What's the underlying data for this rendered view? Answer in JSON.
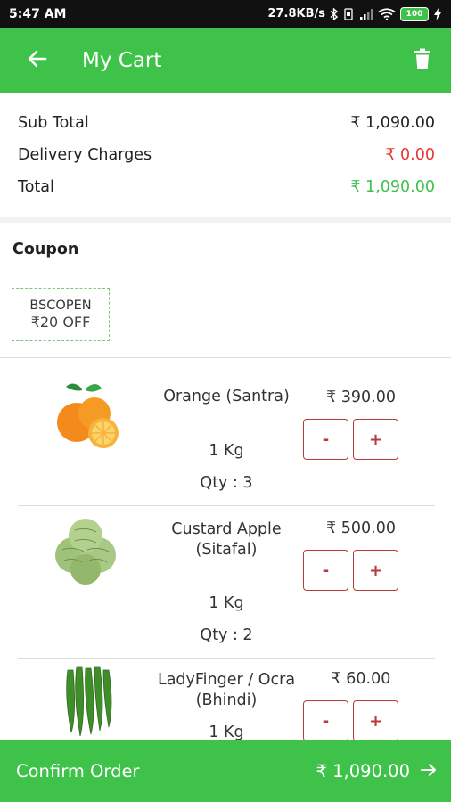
{
  "status_bar": {
    "time": "5:47 AM",
    "network_speed": "27.8KB/s",
    "battery_level": "100"
  },
  "app_bar": {
    "title": "My Cart",
    "back_icon": "arrow-left-icon",
    "delete_icon": "trash-icon"
  },
  "summary": {
    "subtotal_label": "Sub Total",
    "subtotal_value": "₹ 1,090.00",
    "delivery_label": "Delivery Charges",
    "delivery_value": "₹ 0.00",
    "total_label": "Total",
    "total_value": "₹ 1,090.00"
  },
  "coupon": {
    "heading": "Coupon",
    "code": "BSCOPEN",
    "discount": "₹20 OFF"
  },
  "items": [
    {
      "name": "Orange (Santra)",
      "unit": "1 Kg",
      "qty": "Qty : 3",
      "price": "₹ 390.00",
      "minus_label": "-",
      "plus_label": "+"
    },
    {
      "name": "Custard Apple (Sitafal)",
      "unit": "1 Kg",
      "qty": "Qty : 2",
      "price": "₹ 500.00",
      "minus_label": "-",
      "plus_label": "+"
    },
    {
      "name": "LadyFinger / Ocra (Bhindi)",
      "unit": "1 Kg",
      "qty": "",
      "price": "₹ 60.00",
      "minus_label": "-",
      "plus_label": "+"
    }
  ],
  "bottom_bar": {
    "confirm_label": "Confirm Order",
    "total": "₹ 1,090.00",
    "arrow_icon": "arrow-right-icon"
  },
  "colors": {
    "brand_green": "#3fc24a",
    "delivery_red": "#e53935",
    "stepper_red": "#b83b3b"
  }
}
